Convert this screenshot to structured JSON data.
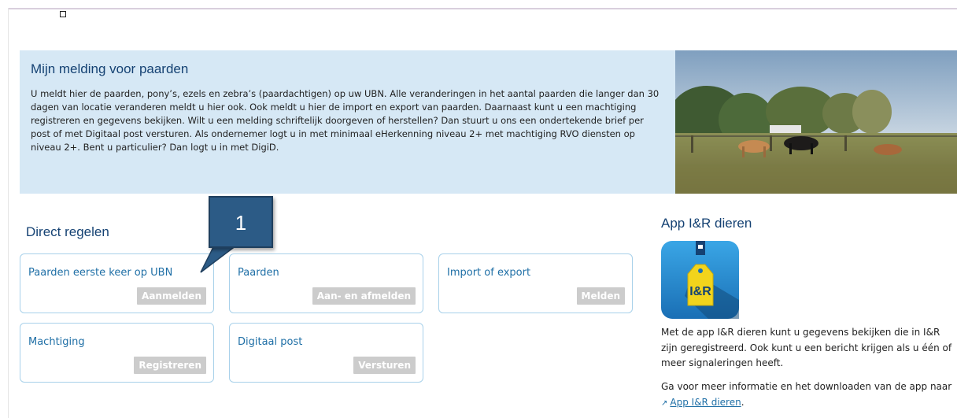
{
  "banner": {
    "title": "Mijn melding voor paarden",
    "text": "U meldt hier de paarden, pony’s, ezels en zebra’s (paardachtigen) op uw UBN. Alle veranderingen in het aantal paarden die langer dan 30 dagen van locatie veranderen meldt u hier ook. Ook meldt u hier de import en export van paarden. Daarnaast kunt u een machtiging registreren en gegevens bekijken. Wilt u een melding schriftelijk doorgeven of herstellen? Dan stuurt u ons een ondertekende brief per post of met Digitaal post versturen. Als ondernemer logt u in met minimaal eHerkenning niveau 2+ met machtiging RVO diensten op niveau 2+. Bent u particulier? Dan logt u in met DigiD."
  },
  "direct": {
    "title": "Direct regelen",
    "cards": [
      {
        "title": "Paarden eerste keer op UBN",
        "button": "Aanmelden"
      },
      {
        "title": "Paarden",
        "button": "Aan- en afmelden"
      },
      {
        "title": "Import of export",
        "button": "Melden"
      },
      {
        "title": "Machtiging",
        "button": "Registreren"
      },
      {
        "title": "Digitaal post",
        "button": "Versturen"
      }
    ]
  },
  "callout": {
    "label": "1"
  },
  "app": {
    "title": "App I&R dieren",
    "icon_text": "I&R",
    "description": "Met de app I&R dieren kunt u gegevens bekijken die in I&R zijn geregistreerd. Ook kunt u een bericht krijgen als u één of meer signaleringen heeft.",
    "more_prefix": "Ga voor meer informatie en het downloaden van de app naar",
    "link_text": "App I&R dieren",
    "more_suffix": "."
  },
  "colors": {
    "banner_bg": "#d6e8f5",
    "heading": "#154273",
    "link": "#1f6fa6",
    "button_disabled": "#cccccc",
    "callout": "#2c5b86"
  }
}
